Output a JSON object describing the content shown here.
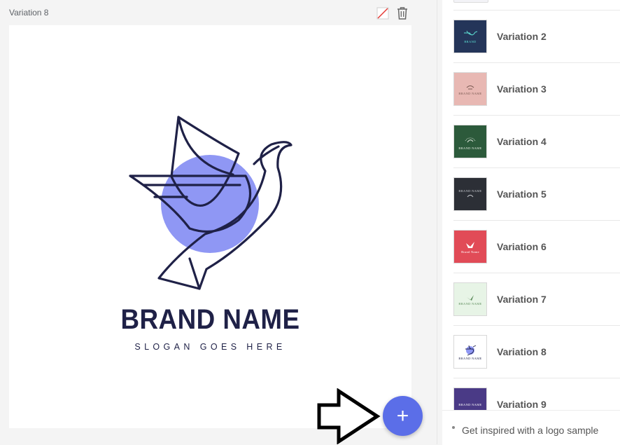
{
  "editor": {
    "variation_title": "Variation 8",
    "colors": {
      "canvas_background": "#ffffff",
      "mark_stroke": "#1f2147",
      "mark_circle": "#8f97f4",
      "fab": "#5b6ee8"
    },
    "logo": {
      "brand_name": "BRAND NAME",
      "slogan": "SLOGAN GOES HERE",
      "mark_icon": "dove-line-art-icon"
    },
    "icons": {
      "no_color": "no-color-icon",
      "delete": "trash-icon",
      "pointer": "arrow-right-outline-icon"
    },
    "add_button_label": "+"
  },
  "variations_panel": {
    "items": [
      {
        "label": "Variation 2",
        "thumb_bg": "#243559",
        "thumb_text": "BRAND",
        "thumb_fg": "#5de0d4"
      },
      {
        "label": "Variation 3",
        "thumb_bg": "#e8b8b3",
        "thumb_text": "BRAND NAME",
        "thumb_fg": "#7a5a52"
      },
      {
        "label": "Variation 4",
        "thumb_bg": "#2c5a3b",
        "thumb_text": "BRAND NAME",
        "thumb_fg": "#e9efe6"
      },
      {
        "label": "Variation 5",
        "thumb_bg": "#2c2f36",
        "thumb_text": "BRAND NAME",
        "thumb_fg": "#c9cbd1"
      },
      {
        "label": "Variation 6",
        "thumb_bg": "#e14b57",
        "thumb_text": "Brand Name",
        "thumb_fg": "#ffffff"
      },
      {
        "label": "Variation 7",
        "thumb_bg": "#e7f4e6",
        "thumb_text": "BRAND NAME",
        "thumb_fg": "#5b8b5a"
      },
      {
        "label": "Variation 8",
        "thumb_bg": "#ffffff",
        "thumb_text": "BRAND NAME",
        "thumb_fg": "#1f2147"
      },
      {
        "label": "Variation 9",
        "thumb_bg": "#4a3a86",
        "thumb_text": "BRAND NAME",
        "thumb_fg": "#ffffff"
      }
    ],
    "footer_text": "Get inspired with a logo sample"
  }
}
